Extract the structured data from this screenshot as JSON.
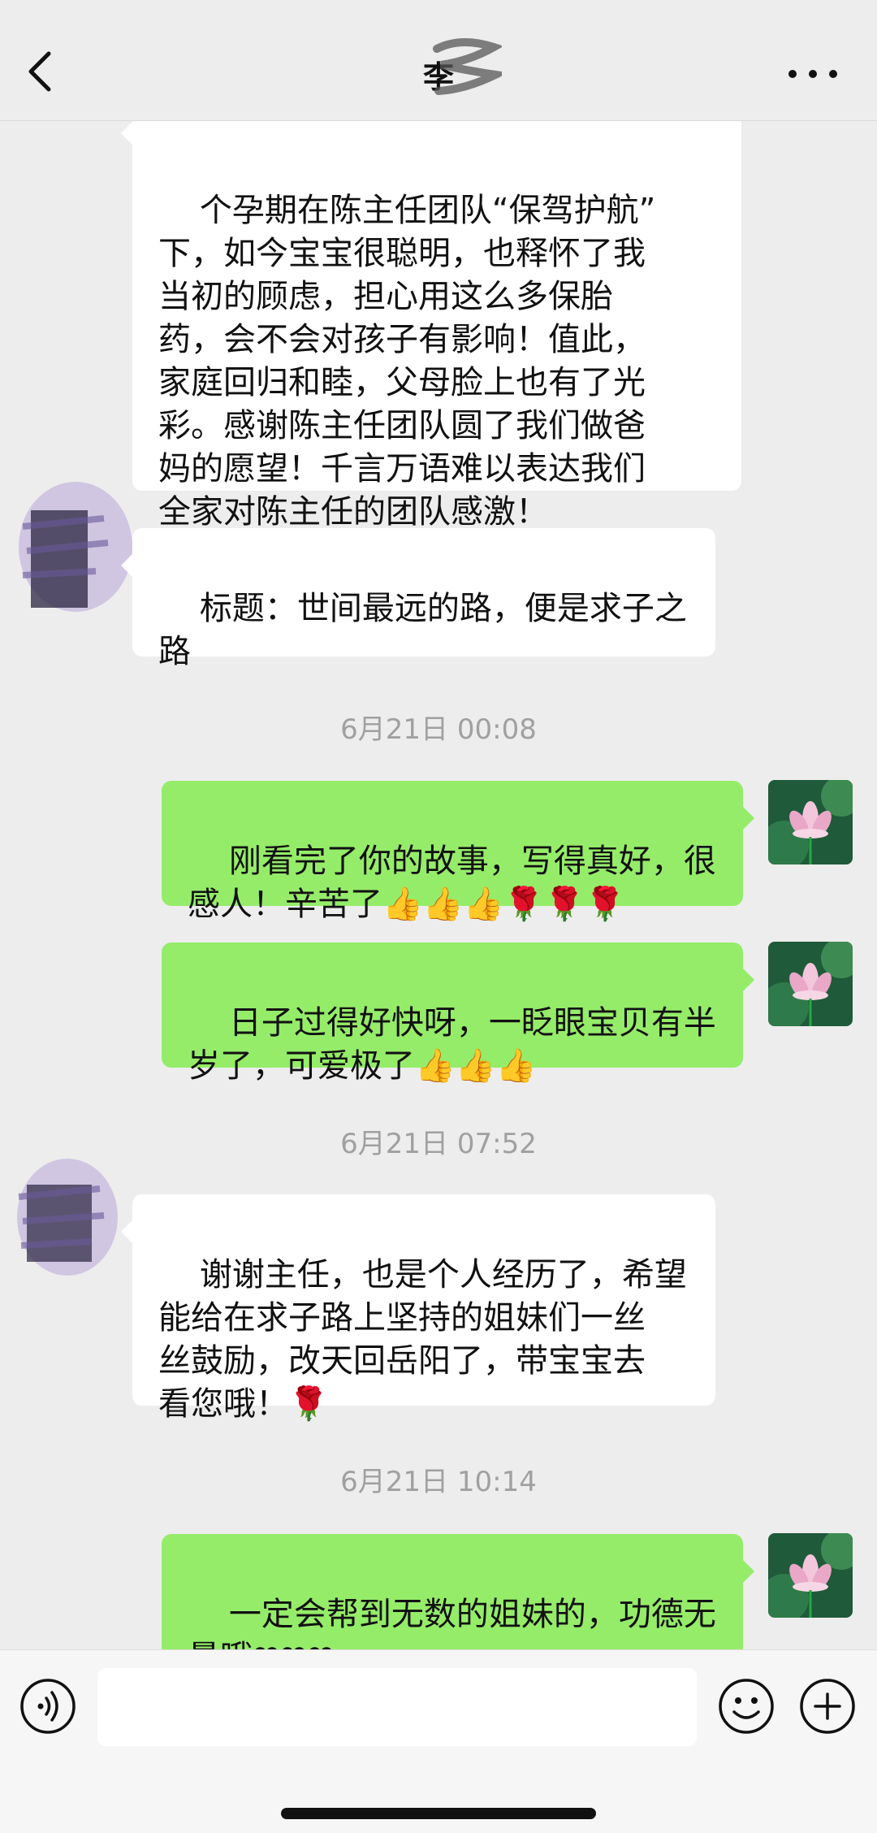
{
  "header": {
    "title": "李"
  },
  "messages": [
    {
      "side": "in",
      "text": "个孕期在陈主任团队“保驾护航”\n下，如今宝宝很聪明，也释怀了我\n当初的顾虑，担心用这么多保胎\n药，会不会对孩子有影响！值此，\n家庭回归和睦，父母脸上也有了光\n彩。感谢陈主任团队圆了我们做爸\n妈的愿望！千言万语难以表达我们\n全家对陈主任的团队感激！"
    },
    {
      "side": "in",
      "text": "标题：世间最远的路，便是求子之\n路"
    },
    {
      "timestamp": "6月21日 00:08"
    },
    {
      "side": "out",
      "text": "刚看完了你的故事，写得真好，很\n感人！辛苦了👍👍👍🌹🌹🌹"
    },
    {
      "side": "out",
      "text": "日子过得好快呀，一眨眼宝贝有半\n岁了，可爱极了👍👍👍"
    },
    {
      "timestamp": "6月21日 07:52"
    },
    {
      "side": "in",
      "text": "谢谢主任，也是个人经历了，希望\n能给在求子路上坚持的姐妹们一丝\n丝鼓励，改天回岳阳了，带宝宝去\n看您哦！🌹"
    },
    {
      "timestamp": "6月21日 10:14"
    },
    {
      "side": "out",
      "text": "一定会帮到无数的姐妹的，功德无\n量哦❤❤❤"
    }
  ],
  "input": {
    "value": ""
  },
  "icons": {
    "back": "chevron-left-icon",
    "more": "more-dots-icon",
    "voice": "voice-icon",
    "emoji": "emoji-icon",
    "plus": "plus-icon"
  },
  "colors": {
    "background": "#ededed",
    "outgoing_bubble": "#95ec69",
    "incoming_bubble": "#ffffff",
    "timestamp": "#a0a0a0"
  }
}
